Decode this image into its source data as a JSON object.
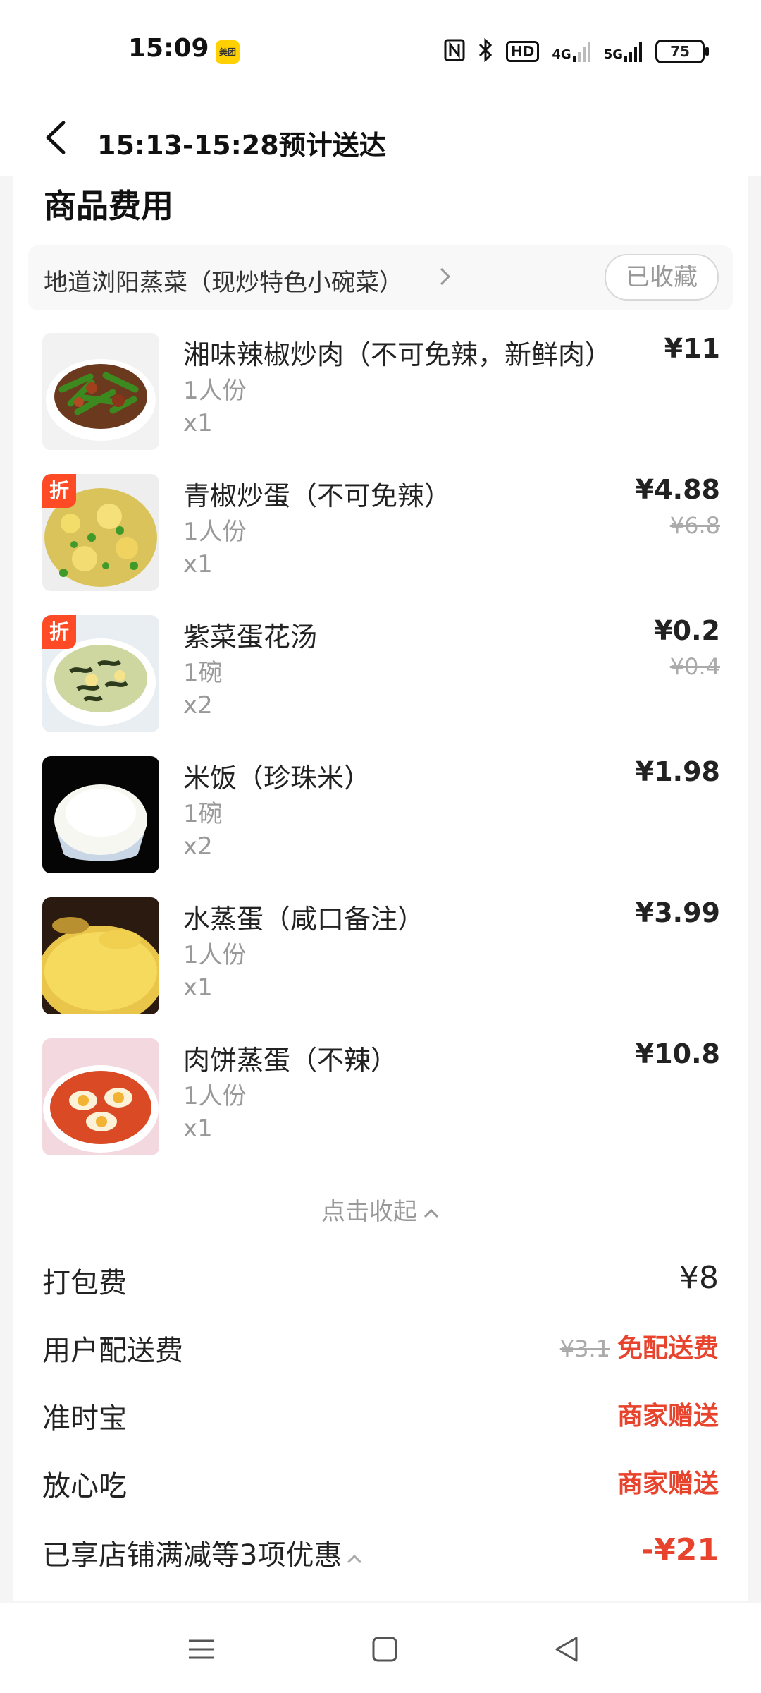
{
  "status_bar": {
    "time": "15:09",
    "app_badge": "美团",
    "icons": [
      "nfc-icon",
      "bluetooth-icon",
      "hd-icon",
      "signal-4g-icon",
      "signal-5g-icon"
    ],
    "hd_label": "HD",
    "net4g": "4G",
    "net5g": "5G",
    "battery": "75"
  },
  "header": {
    "title": "15:13-15:28预计送达"
  },
  "section": {
    "title": "商品费用"
  },
  "shop": {
    "name": "地道浏阳蒸菜（现炒特色小碗菜）",
    "favorite_label": "已收藏"
  },
  "items": [
    {
      "name": "湘味辣椒炒肉（不可免辣，新鲜肉）",
      "spec": "1人份",
      "qty": "x1",
      "price": "¥11",
      "original_price": "",
      "discount_tag": ""
    },
    {
      "name": "青椒炒蛋（不可免辣）",
      "spec": "1人份",
      "qty": "x1",
      "price": "¥4.88",
      "original_price": "¥6.8",
      "discount_tag": "折"
    },
    {
      "name": "紫菜蛋花汤",
      "spec": "1碗",
      "qty": "x2",
      "price": "¥0.2",
      "original_price": "¥0.4",
      "discount_tag": "折"
    },
    {
      "name": "米饭（珍珠米）",
      "spec": "1碗",
      "qty": "x2",
      "price": "¥1.98",
      "original_price": "",
      "discount_tag": ""
    },
    {
      "name": "水蒸蛋（咸口备注）",
      "spec": "1人份",
      "qty": "x1",
      "price": "¥3.99",
      "original_price": "",
      "discount_tag": ""
    },
    {
      "name": "肉饼蒸蛋（不辣）",
      "spec": "1人份",
      "qty": "x1",
      "price": "¥10.8",
      "original_price": "",
      "discount_tag": ""
    }
  ],
  "collapse_label": "点击收起",
  "fees": {
    "packing": {
      "label": "打包费",
      "value": "¥8"
    },
    "delivery": {
      "label": "用户配送费",
      "original": "¥3.1",
      "value": "免配送费"
    },
    "ontime": {
      "label": "准时宝",
      "value": "商家赠送"
    },
    "safe": {
      "label": "放心吃",
      "value": "商家赠送"
    },
    "promo": {
      "label": "已享店铺满减等3项优惠",
      "value": "-¥21"
    }
  },
  "colors": {
    "accent_red": "#e8432c",
    "discount_tag": "#ff4a26",
    "meituan_yellow": "#ffd100"
  }
}
